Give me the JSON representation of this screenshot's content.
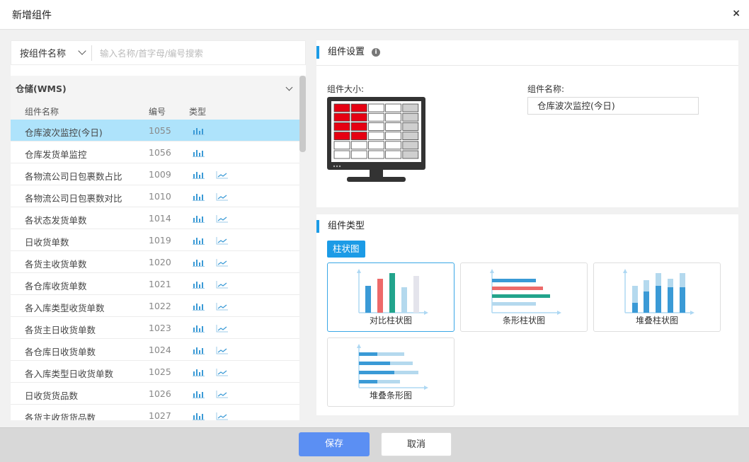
{
  "dialog": {
    "title": "新增组件",
    "close_glyph": "×"
  },
  "search": {
    "mode_label": "按组件名称",
    "placeholder": "输入名称/首字母/编号搜索"
  },
  "list": {
    "group_title": "仓储(WMS)",
    "columns": {
      "name": "组件名称",
      "code": "编号",
      "type": "类型"
    },
    "rows": [
      {
        "name": "仓库波次监控(今日)",
        "code": "1055",
        "types": [
          "bar"
        ]
      },
      {
        "name": "仓库发货单监控",
        "code": "1056",
        "types": [
          "bar"
        ]
      },
      {
        "name": "各物流公司日包裹数占比",
        "code": "1009",
        "types": [
          "bar",
          "line"
        ]
      },
      {
        "name": "各物流公司日包裹数对比",
        "code": "1010",
        "types": [
          "bar",
          "line"
        ]
      },
      {
        "name": "各状态发货单数",
        "code": "1014",
        "types": [
          "bar",
          "line"
        ]
      },
      {
        "name": "日收货单数",
        "code": "1019",
        "types": [
          "bar",
          "line"
        ]
      },
      {
        "name": "各货主收货单数",
        "code": "1020",
        "types": [
          "bar",
          "line"
        ]
      },
      {
        "name": "各仓库收货单数",
        "code": "1021",
        "types": [
          "bar",
          "line"
        ]
      },
      {
        "name": "各入库类型收货单数",
        "code": "1022",
        "types": [
          "bar",
          "line"
        ]
      },
      {
        "name": "各货主日收货单数",
        "code": "1023",
        "types": [
          "bar",
          "line"
        ]
      },
      {
        "name": "各仓库日收货单数",
        "code": "1024",
        "types": [
          "bar",
          "line"
        ]
      },
      {
        "name": "各入库类型日收货单数",
        "code": "1025",
        "types": [
          "bar",
          "line"
        ]
      },
      {
        "name": "日收货货品数",
        "code": "1026",
        "types": [
          "bar",
          "line"
        ]
      },
      {
        "name": "各货主收货货品数",
        "code": "1027",
        "types": [
          "bar",
          "line"
        ]
      }
    ],
    "selected_index": 0
  },
  "settings": {
    "title": "组件设置",
    "size_label": "组件大小:",
    "name_label": "组件名称:",
    "name_value": "仓库波次监控(今日)",
    "grid": {
      "columns": 5,
      "rows": 6,
      "selected_columns": 2,
      "selected_rows": 4,
      "selected_color": "#e60012"
    }
  },
  "types_panel": {
    "title": "组件类型",
    "category_tag": "柱状图",
    "cards": [
      {
        "caption": "对比柱状图",
        "kind": "compare-bar",
        "active": true
      },
      {
        "caption": "条形柱状图",
        "kind": "horizontal-bar",
        "active": false
      },
      {
        "caption": "堆叠柱状图",
        "kind": "stacked-bar",
        "active": false
      },
      {
        "caption": "堆叠条形图",
        "kind": "stacked-horizontal-bar",
        "active": false
      }
    ]
  },
  "footer": {
    "save_label": "保存",
    "cancel_label": "取消"
  },
  "colors": {
    "accent": "#1c9be6",
    "save_button": "#5b8ff3",
    "selected_row": "#aee3fb"
  }
}
